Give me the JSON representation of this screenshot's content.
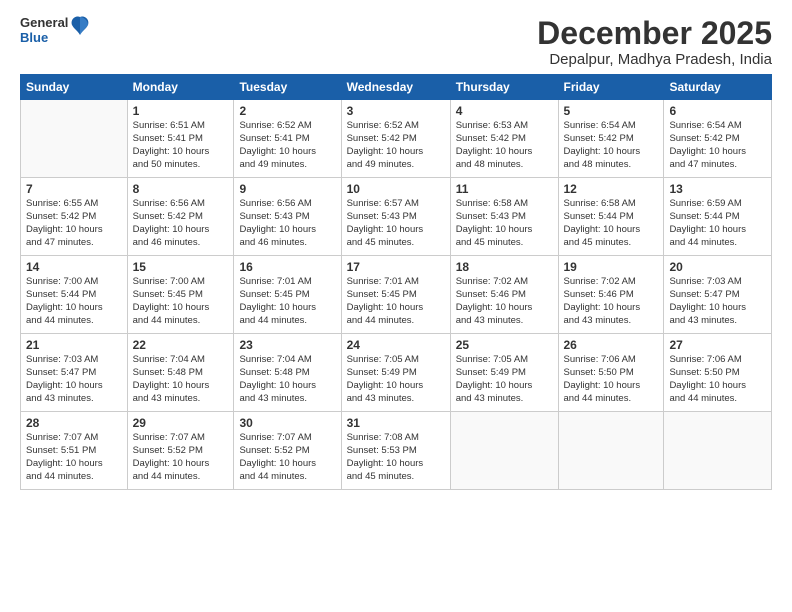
{
  "logo": {
    "line1": "General",
    "line2": "Blue"
  },
  "header": {
    "month": "December 2025",
    "location": "Depalpur, Madhya Pradesh, India"
  },
  "weekdays": [
    "Sunday",
    "Monday",
    "Tuesday",
    "Wednesday",
    "Thursday",
    "Friday",
    "Saturday"
  ],
  "weeks": [
    [
      {
        "day": "",
        "info": ""
      },
      {
        "day": "1",
        "info": "Sunrise: 6:51 AM\nSunset: 5:41 PM\nDaylight: 10 hours\nand 50 minutes."
      },
      {
        "day": "2",
        "info": "Sunrise: 6:52 AM\nSunset: 5:41 PM\nDaylight: 10 hours\nand 49 minutes."
      },
      {
        "day": "3",
        "info": "Sunrise: 6:52 AM\nSunset: 5:42 PM\nDaylight: 10 hours\nand 49 minutes."
      },
      {
        "day": "4",
        "info": "Sunrise: 6:53 AM\nSunset: 5:42 PM\nDaylight: 10 hours\nand 48 minutes."
      },
      {
        "day": "5",
        "info": "Sunrise: 6:54 AM\nSunset: 5:42 PM\nDaylight: 10 hours\nand 48 minutes."
      },
      {
        "day": "6",
        "info": "Sunrise: 6:54 AM\nSunset: 5:42 PM\nDaylight: 10 hours\nand 47 minutes."
      }
    ],
    [
      {
        "day": "7",
        "info": "Sunrise: 6:55 AM\nSunset: 5:42 PM\nDaylight: 10 hours\nand 47 minutes."
      },
      {
        "day": "8",
        "info": "Sunrise: 6:56 AM\nSunset: 5:42 PM\nDaylight: 10 hours\nand 46 minutes."
      },
      {
        "day": "9",
        "info": "Sunrise: 6:56 AM\nSunset: 5:43 PM\nDaylight: 10 hours\nand 46 minutes."
      },
      {
        "day": "10",
        "info": "Sunrise: 6:57 AM\nSunset: 5:43 PM\nDaylight: 10 hours\nand 45 minutes."
      },
      {
        "day": "11",
        "info": "Sunrise: 6:58 AM\nSunset: 5:43 PM\nDaylight: 10 hours\nand 45 minutes."
      },
      {
        "day": "12",
        "info": "Sunrise: 6:58 AM\nSunset: 5:44 PM\nDaylight: 10 hours\nand 45 minutes."
      },
      {
        "day": "13",
        "info": "Sunrise: 6:59 AM\nSunset: 5:44 PM\nDaylight: 10 hours\nand 44 minutes."
      }
    ],
    [
      {
        "day": "14",
        "info": "Sunrise: 7:00 AM\nSunset: 5:44 PM\nDaylight: 10 hours\nand 44 minutes."
      },
      {
        "day": "15",
        "info": "Sunrise: 7:00 AM\nSunset: 5:45 PM\nDaylight: 10 hours\nand 44 minutes."
      },
      {
        "day": "16",
        "info": "Sunrise: 7:01 AM\nSunset: 5:45 PM\nDaylight: 10 hours\nand 44 minutes."
      },
      {
        "day": "17",
        "info": "Sunrise: 7:01 AM\nSunset: 5:45 PM\nDaylight: 10 hours\nand 44 minutes."
      },
      {
        "day": "18",
        "info": "Sunrise: 7:02 AM\nSunset: 5:46 PM\nDaylight: 10 hours\nand 43 minutes."
      },
      {
        "day": "19",
        "info": "Sunrise: 7:02 AM\nSunset: 5:46 PM\nDaylight: 10 hours\nand 43 minutes."
      },
      {
        "day": "20",
        "info": "Sunrise: 7:03 AM\nSunset: 5:47 PM\nDaylight: 10 hours\nand 43 minutes."
      }
    ],
    [
      {
        "day": "21",
        "info": "Sunrise: 7:03 AM\nSunset: 5:47 PM\nDaylight: 10 hours\nand 43 minutes."
      },
      {
        "day": "22",
        "info": "Sunrise: 7:04 AM\nSunset: 5:48 PM\nDaylight: 10 hours\nand 43 minutes."
      },
      {
        "day": "23",
        "info": "Sunrise: 7:04 AM\nSunset: 5:48 PM\nDaylight: 10 hours\nand 43 minutes."
      },
      {
        "day": "24",
        "info": "Sunrise: 7:05 AM\nSunset: 5:49 PM\nDaylight: 10 hours\nand 43 minutes."
      },
      {
        "day": "25",
        "info": "Sunrise: 7:05 AM\nSunset: 5:49 PM\nDaylight: 10 hours\nand 43 minutes."
      },
      {
        "day": "26",
        "info": "Sunrise: 7:06 AM\nSunset: 5:50 PM\nDaylight: 10 hours\nand 44 minutes."
      },
      {
        "day": "27",
        "info": "Sunrise: 7:06 AM\nSunset: 5:50 PM\nDaylight: 10 hours\nand 44 minutes."
      }
    ],
    [
      {
        "day": "28",
        "info": "Sunrise: 7:07 AM\nSunset: 5:51 PM\nDaylight: 10 hours\nand 44 minutes."
      },
      {
        "day": "29",
        "info": "Sunrise: 7:07 AM\nSunset: 5:52 PM\nDaylight: 10 hours\nand 44 minutes."
      },
      {
        "day": "30",
        "info": "Sunrise: 7:07 AM\nSunset: 5:52 PM\nDaylight: 10 hours\nand 44 minutes."
      },
      {
        "day": "31",
        "info": "Sunrise: 7:08 AM\nSunset: 5:53 PM\nDaylight: 10 hours\nand 45 minutes."
      },
      {
        "day": "",
        "info": ""
      },
      {
        "day": "",
        "info": ""
      },
      {
        "day": "",
        "info": ""
      }
    ]
  ]
}
